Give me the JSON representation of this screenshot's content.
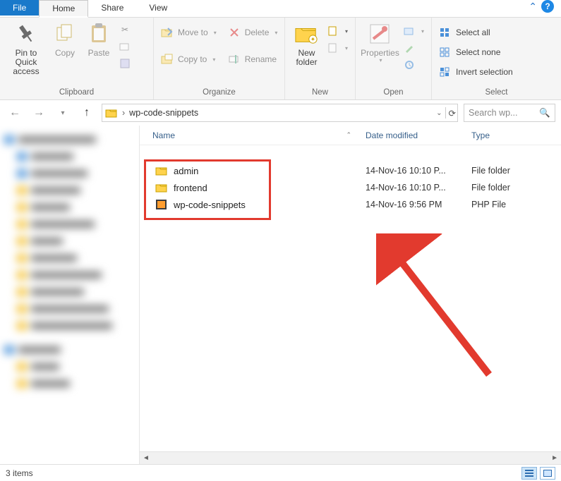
{
  "tabs": {
    "file": "File",
    "home": "Home",
    "share": "Share",
    "view": "View"
  },
  "ribbon": {
    "clipboard": {
      "label": "Clipboard",
      "pin": "Pin to Quick\naccess",
      "copy": "Copy",
      "paste": "Paste"
    },
    "organize": {
      "label": "Organize",
      "move_to": "Move to",
      "copy_to": "Copy to",
      "delete": "Delete",
      "rename": "Rename"
    },
    "new": {
      "label": "New",
      "new_folder": "New\nfolder"
    },
    "open": {
      "label": "Open",
      "properties": "Properties"
    },
    "select": {
      "label": "Select",
      "select_all": "Select all",
      "select_none": "Select none",
      "invert": "Invert selection"
    }
  },
  "address": {
    "folder": "wp-code-snippets"
  },
  "search": {
    "placeholder": "Search wp..."
  },
  "columns": {
    "name": "Name",
    "date": "Date modified",
    "type": "Type"
  },
  "rows": [
    {
      "name": "admin",
      "date": "14-Nov-16 10:10 P...",
      "type": "File folder",
      "icon": "folder"
    },
    {
      "name": "frontend",
      "date": "14-Nov-16 10:10 P...",
      "type": "File folder",
      "icon": "folder"
    },
    {
      "name": "wp-code-snippets",
      "date": "14-Nov-16 9:56 PM",
      "type": "PHP File",
      "icon": "php"
    }
  ],
  "status": {
    "count": "3 items"
  }
}
